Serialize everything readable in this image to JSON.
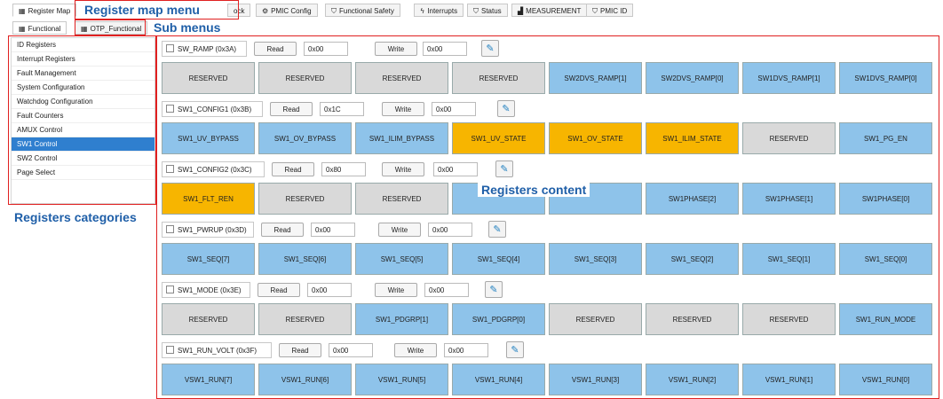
{
  "top_tabs": [
    {
      "label": "Register Map",
      "icon": "grid-icon"
    },
    {
      "label": "ock",
      "icon": ""
    },
    {
      "label": "PMIC Config",
      "icon": "gear-icon"
    },
    {
      "label": "Functional Safety",
      "icon": "shield-icon"
    },
    {
      "label": "Interrupts",
      "icon": "bolt-icon"
    },
    {
      "label": "Status",
      "icon": "shield-icon"
    },
    {
      "label": "MEASUREMENT",
      "icon": "chart-icon"
    },
    {
      "label": "PMIC ID",
      "icon": "shield-icon"
    }
  ],
  "sub_tabs": [
    {
      "label": "Functional"
    },
    {
      "label": "OTP_Functional"
    }
  ],
  "annotations": {
    "register_map_menu": "Register map menu",
    "sub_menus": "Sub menus",
    "registers_content": "Registers content",
    "registers_categories": "Registers categories"
  },
  "categories": [
    "ID Registers",
    "Interrupt Registers",
    "Fault Management",
    "System Configuration",
    "Watchdog Configuration",
    "Fault Counters",
    "AMUX Control",
    "SW1 Control",
    "SW2 Control",
    "Page Select"
  ],
  "selected_category": "SW1 Control",
  "buttons": {
    "read": "Read",
    "write": "Write"
  },
  "registers": [
    {
      "name": "SW_RAMP (0x3A)",
      "read_value": "0x00",
      "write_value": "0x00",
      "bits": [
        [
          "RESERVED",
          "gray"
        ],
        [
          "RESERVED",
          "gray"
        ],
        [
          "RESERVED",
          "gray"
        ],
        [
          "RESERVED",
          "gray"
        ],
        [
          "SW2DVS_RAMP[1]",
          "blue"
        ],
        [
          "SW2DVS_RAMP[0]",
          "blue"
        ],
        [
          "SW1DVS_RAMP[1]",
          "blue"
        ],
        [
          "SW1DVS_RAMP[0]",
          "blue"
        ]
      ]
    },
    {
      "name": "SW1_CONFIG1 (0x3B)",
      "read_value": "0x1C",
      "write_value": "0x00",
      "bits": [
        [
          "SW1_UV_BYPASS",
          "blue"
        ],
        [
          "SW1_OV_BYPASS",
          "blue"
        ],
        [
          "SW1_ILIM_BYPASS",
          "blue"
        ],
        [
          "SW1_UV_STATE",
          "orange"
        ],
        [
          "SW1_OV_STATE",
          "orange"
        ],
        [
          "SW1_ILIM_STATE",
          "orange"
        ],
        [
          "RESERVED",
          "gray"
        ],
        [
          "SW1_PG_EN",
          "blue"
        ]
      ]
    },
    {
      "name": "SW1_CONFIG2 (0x3C)",
      "read_value": "0x80",
      "write_value": "0x00",
      "bits": [
        [
          "SW1_FLT_REN",
          "orange"
        ],
        [
          "RESERVED",
          "gray"
        ],
        [
          "RESERVED",
          "gray"
        ],
        [
          "",
          "blue"
        ],
        [
          "",
          "blue"
        ],
        [
          "SW1PHASE[2]",
          "blue"
        ],
        [
          "SW1PHASE[1]",
          "blue"
        ],
        [
          "SW1PHASE[0]",
          "blue"
        ]
      ]
    },
    {
      "name": "SW1_PWRUP (0x3D)",
      "read_value": "0x00",
      "write_value": "0x00",
      "bits": [
        [
          "SW1_SEQ[7]",
          "blue"
        ],
        [
          "SW1_SEQ[6]",
          "blue"
        ],
        [
          "SW1_SEQ[5]",
          "blue"
        ],
        [
          "SW1_SEQ[4]",
          "blue"
        ],
        [
          "SW1_SEQ[3]",
          "blue"
        ],
        [
          "SW1_SEQ[2]",
          "blue"
        ],
        [
          "SW1_SEQ[1]",
          "blue"
        ],
        [
          "SW1_SEQ[0]",
          "blue"
        ]
      ]
    },
    {
      "name": "SW1_MODE (0x3E)",
      "read_value": "0x00",
      "write_value": "0x00",
      "bits": [
        [
          "RESERVED",
          "gray"
        ],
        [
          "RESERVED",
          "gray"
        ],
        [
          "SW1_PDGRP[1]",
          "blue"
        ],
        [
          "SW1_PDGRP[0]",
          "blue"
        ],
        [
          "RESERVED",
          "gray"
        ],
        [
          "RESERVED",
          "gray"
        ],
        [
          "RESERVED",
          "gray"
        ],
        [
          "SW1_RUN_MODE",
          "blue"
        ]
      ]
    },
    {
      "name": "SW1_RUN_VOLT (0x3F)",
      "read_value": "0x00",
      "write_value": "0x00",
      "bits": [
        [
          "VSW1_RUN[7]",
          "blue"
        ],
        [
          "VSW1_RUN[6]",
          "blue"
        ],
        [
          "VSW1_RUN[5]",
          "blue"
        ],
        [
          "VSW1_RUN[4]",
          "blue"
        ],
        [
          "VSW1_RUN[3]",
          "blue"
        ],
        [
          "VSW1_RUN[2]",
          "blue"
        ],
        [
          "VSW1_RUN[1]",
          "blue"
        ],
        [
          "VSW1_RUN[0]",
          "blue"
        ]
      ]
    }
  ]
}
